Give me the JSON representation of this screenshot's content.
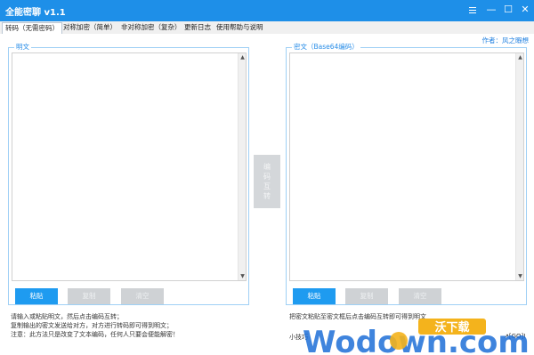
{
  "window": {
    "title": "全能密聊 v1.1",
    "controls": {
      "settings_icon": "settings-icon",
      "minimize": "—",
      "maximize": "☐",
      "close": "✕"
    }
  },
  "tabs": [
    {
      "label": "转码（无需密码）",
      "active": true
    },
    {
      "label": "对称加密（简单）",
      "active": false
    },
    {
      "label": "非对称加密（复杂）",
      "active": false
    },
    {
      "label": "更新日志",
      "active": false
    },
    {
      "label": "使用帮助与说明",
      "active": false
    }
  ],
  "author": "作者：风之暇想",
  "left_panel": {
    "label": "明文",
    "buttons": {
      "paste": "粘贴",
      "copy": "复制",
      "clear": "清空"
    }
  },
  "right_panel": {
    "label": "密文（Base64编码）",
    "buttons": {
      "paste": "粘贴",
      "copy": "复制",
      "clear": "清空"
    }
  },
  "convert_button": {
    "label": "编码互转"
  },
  "instructions": [
    "请输入或粘贴明文，然后点击编码互转；",
    "复制输出的密文发送给对方，对方进行转码即可得到明文；",
    "注意：此方法只是改变了文本编码，任何人只要会便能解密！"
  ],
  "right_notes": {
    "line1": "把密文粘贴至密文框后点击编码互转即可得到明文",
    "line2_prefix": "小技巧",
    "line2_suffix": "↗[GO]!"
  },
  "watermark": {
    "text_top": "沃下载",
    "text_main": "Wodown.com"
  },
  "colors": {
    "accent": "#1e9bf0",
    "titlebar": "#1e8fe8",
    "watermark_orange": "#f4b31c",
    "watermark_blue": "#1e6fd8"
  }
}
